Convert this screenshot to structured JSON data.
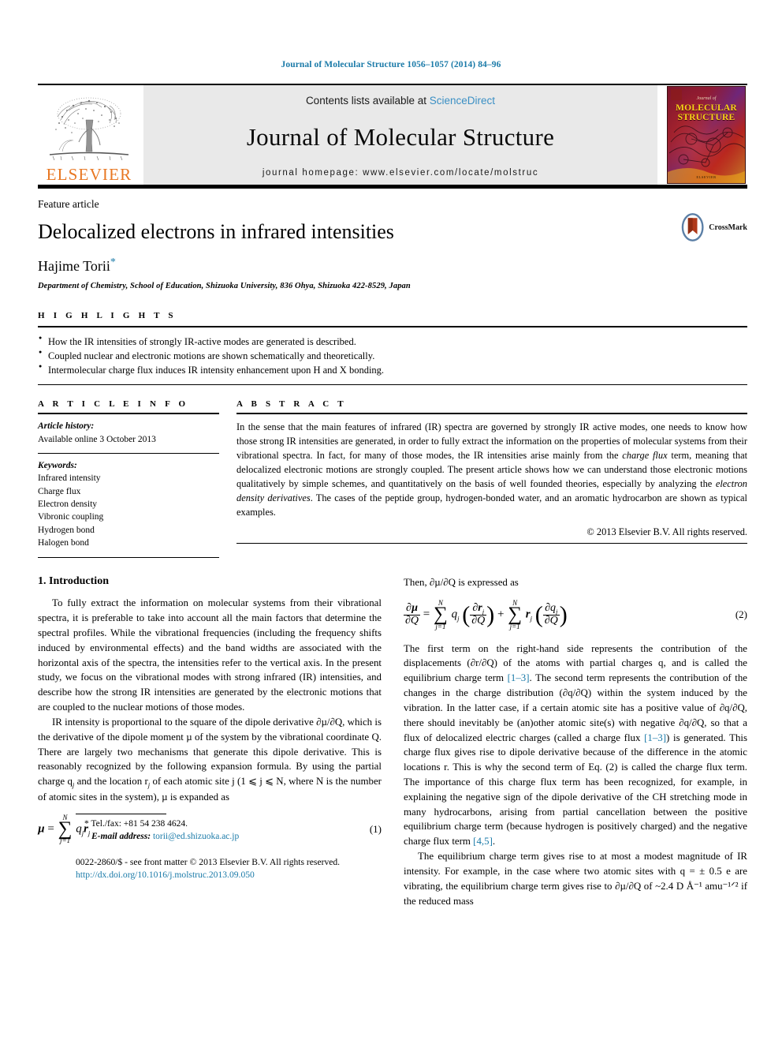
{
  "running_head": "Journal of Molecular Structure 1056–1057 (2014) 84–96",
  "masthead": {
    "publisher_name": "ELSEVIER",
    "contents_prefix": "Contents lists available at ",
    "sciencedirect": "ScienceDirect",
    "journal_title": "Journal of Molecular Structure",
    "homepage": "journal homepage: www.elsevier.com/locate/molstruc",
    "cover": {
      "sub": "Journal of",
      "title_line1": "MOLECULAR",
      "title_line2": "STRUCTURE",
      "bottom": "ELSEVIER"
    }
  },
  "article": {
    "type_label": "Feature article",
    "title": "Delocalized electrons in infrared intensities",
    "author": "Hajime Torii",
    "author_footnote_mark": "*",
    "affiliation": "Department of Chemistry, School of Education, Shizuoka University, 836 Ohya, Shizuoka 422-8529, Japan",
    "crossmark_label": "CrossMark"
  },
  "highlights": {
    "heading": "H I G H L I G H T S",
    "items": [
      "How the IR intensities of strongly IR-active modes are generated is described.",
      "Coupled nuclear and electronic motions are shown schematically and theoretically.",
      "Intermolecular charge flux induces IR intensity enhancement upon H and X bonding."
    ]
  },
  "article_info": {
    "heading": "A R T I C L E    I N F O",
    "history_label": "Article history:",
    "history_value": "Available online 3 October 2013",
    "keywords_label": "Keywords:",
    "keywords": [
      "Infrared intensity",
      "Charge flux",
      "Electron density",
      "Vibronic coupling",
      "Hydrogen bond",
      "Halogen bond"
    ]
  },
  "abstract": {
    "heading": "A B S T R A C T",
    "part1": "In the sense that the main features of infrared (IR) spectra are governed by strongly IR active modes, one needs to know how those strong IR intensities are generated, in order to fully extract the information on the properties of molecular systems from their vibrational spectra. In fact, for many of those modes, the IR intensities arise mainly from the ",
    "em1": "charge flux",
    "part2": " term, meaning that delocalized electronic motions are strongly coupled. The present article shows how we can understand those electronic motions qualitatively by simple schemes, and quantitatively on the basis of well founded theories, especially by analyzing the ",
    "em2": "electron density derivatives",
    "part3": ". The cases of the peptide group, hydrogen-bonded water, and an aromatic hydrocarbon are shown as typical examples.",
    "copyright": "© 2013 Elsevier B.V. All rights reserved."
  },
  "body": {
    "section1_title": "1. Introduction",
    "left_para1": "To fully extract the information on molecular systems from their vibrational spectra, it is preferable to take into account all the main factors that determine the spectral profiles. While the vibrational frequencies (including the frequency shifts induced by environmental effects) and the band widths are associated with the horizontal axis of the spectra, the intensities refer to the vertical axis. In the present study, we focus on the vibrational modes with strong infrared (IR) intensities, and describe how the strong IR intensities are generated by the electronic motions that are coupled to the nuclear motions of those modes.",
    "left_para2_a": "IR intensity is proportional to the square of the dipole derivative ∂µ/∂Q, which is the derivative of the dipole moment µ of the system by the vibrational coordinate Q. There are largely two mechanisms that generate this dipole derivative. This is reasonably recognized by the following expansion formula. By using the partial charge q",
    "left_para2_b": " and the location r",
    "left_para2_c": " of each atomic site j (1 ⩽ j ⩽ N, where N is the number of atomic sites in the system), µ is expanded as",
    "eq1_number": "(1)",
    "eq1_lhs": "µ",
    "eq1_eq": "=",
    "eq1_sum_top": "N",
    "eq1_sum_bot": "j=1",
    "eq1_body": "q",
    "eq1_body2": "r",
    "right_lead": "Then, ∂µ/∂Q is expressed as",
    "eq2_number": "(2)",
    "right_para1": "The first term on the right-hand side represents the contribution of the displacements (∂r/∂Q) of the atoms with partial charges q, and is called the equilibrium charge term ",
    "right_ref1": "[1–3]",
    "right_para1b": ". The second term represents the contribution of the changes in the charge distribution (∂q/∂Q) within the system induced by the vibration. In the latter case, if a certain atomic site has a positive value of ∂q/∂Q, there should inevitably be (an)other atomic site(s) with negative ∂q/∂Q, so that a flux of delocalized electric charges (called a charge flux ",
    "right_ref2": "[1–3]",
    "right_para1c": ") is generated. This charge flux gives rise to dipole derivative because of the difference in the atomic locations r. This is why the second term of Eq. (2) is called the charge flux term. The importance of this charge flux term has been recognized, for example, in explaining the negative sign of the dipole derivative of the CH stretching mode in many hydrocarbons, arising from partial cancellation between the positive equilibrium charge term (because hydrogen is positively charged) and the negative charge flux term ",
    "right_ref3": "[4,5]",
    "right_para1d": ".",
    "right_para2": "The equilibrium charge term gives rise to at most a modest magnitude of IR intensity. For example, in the case where two atomic sites with q = ± 0.5 e are vibrating, the equilibrium charge term gives rise to ∂µ/∂Q of ~2.4 D Å⁻¹ amu⁻¹ᐟ² if the reduced mass"
  },
  "footnotes": {
    "tel_mark": "*",
    "tel": "Tel./fax: +81 54 238 4624.",
    "email_label": "E-mail address:",
    "email": "torii@ed.shizuoka.ac.jp",
    "issn_line": "0022-2860/$ - see front matter © 2013 Elsevier B.V. All rights reserved.",
    "doi": "http://dx.doi.org/10.1016/j.molstruc.2013.09.050"
  },
  "colors": {
    "link": "#1a7aa8",
    "sciencedirect": "#3a8fc4",
    "elsevier_orange": "#E87722"
  }
}
